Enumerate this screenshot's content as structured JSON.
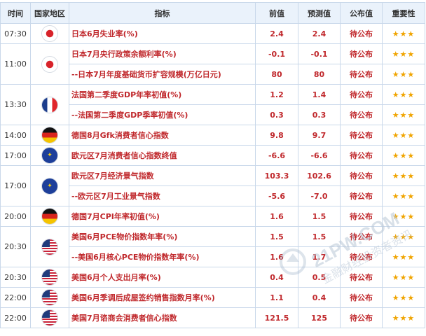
{
  "header": {
    "time": "时间",
    "country": "国家地区",
    "indicator": "指标",
    "previous": "前值",
    "forecast": "预测值",
    "published": "公布值",
    "importance": "重要性"
  },
  "rows": [
    {
      "time": "07:30",
      "flag": "jp",
      "flag_icon": "japan-flag-icon",
      "indicator": "日本6月失业率(%)",
      "previous": "2.4",
      "forecast": "2.4",
      "published": "待公布",
      "stars": "★★★"
    },
    {
      "time": "11:00",
      "flag": "jp",
      "flag_icon": "japan-flag-icon",
      "indicator": "日本7月央行政策余额利率(%)",
      "previous": "-0.1",
      "forecast": "-0.1",
      "published": "待公布",
      "stars": "★★★"
    },
    {
      "time": "",
      "flag": "",
      "flag_icon": "",
      "indicator": "--日本7月年度基础货币扩容规模(万亿日元)",
      "previous": "80",
      "forecast": "80",
      "published": "待公布",
      "stars": "★★★"
    },
    {
      "time": "13:30",
      "flag": "fr",
      "flag_icon": "france-flag-icon",
      "indicator": "法国第二季度GDP年率初值(%)",
      "previous": "1.2",
      "forecast": "1.4",
      "published": "待公布",
      "stars": "★★★"
    },
    {
      "time": "",
      "flag": "",
      "flag_icon": "",
      "indicator": "--法国第二季度GDP季率初值(%)",
      "previous": "0.3",
      "forecast": "0.3",
      "published": "待公布",
      "stars": "★★★"
    },
    {
      "time": "14:00",
      "flag": "de",
      "flag_icon": "germany-flag-icon",
      "indicator": "德国8月Gfk消费者信心指数",
      "previous": "9.8",
      "forecast": "9.7",
      "published": "待公布",
      "stars": "★★★"
    },
    {
      "time": "17:00",
      "flag": "eu",
      "flag_icon": "eu-flag-icon",
      "indicator": "欧元区7月消费者信心指数终值",
      "previous": "-6.6",
      "forecast": "-6.6",
      "published": "待公布",
      "stars": "★★★"
    },
    {
      "time": "17:00",
      "flag": "eu",
      "flag_icon": "eu-flag-icon",
      "indicator": "欧元区7月经济景气指数",
      "previous": "103.3",
      "forecast": "102.6",
      "published": "待公布",
      "stars": "★★★"
    },
    {
      "time": "",
      "flag": "",
      "flag_icon": "",
      "indicator": "--欧元区7月工业景气指数",
      "previous": "-5.6",
      "forecast": "-7.0",
      "published": "待公布",
      "stars": "★★★"
    },
    {
      "time": "20:00",
      "flag": "de",
      "flag_icon": "germany-flag-icon",
      "indicator": "德国7月CPI年率初值(%)",
      "previous": "1.6",
      "forecast": "1.5",
      "published": "待公布",
      "stars": "★★★"
    },
    {
      "time": "20:30",
      "flag": "us",
      "flag_icon": "usa-flag-icon",
      "indicator": "美国6月PCE物价指数年率(%)",
      "previous": "1.5",
      "forecast": "1.5",
      "published": "待公布",
      "stars": "★★★"
    },
    {
      "time": "",
      "flag": "",
      "flag_icon": "",
      "indicator": "--美国6月核心PCE物价指数年率(%)",
      "previous": "1.6",
      "forecast": "1.7",
      "published": "待公布",
      "stars": "★★★"
    },
    {
      "time": "20:30",
      "flag": "us",
      "flag_icon": "usa-flag-icon",
      "indicator": "美国6月个人支出月率(%)",
      "previous": "0.4",
      "forecast": "0.5",
      "published": "待公布",
      "stars": "★★★"
    },
    {
      "time": "22:00",
      "flag": "us",
      "flag_icon": "usa-flag-icon",
      "indicator": "美国6月季调后成屋签约销售指数月率(%)",
      "previous": "1.1",
      "forecast": "0.4",
      "published": "待公布",
      "stars": "★★★"
    },
    {
      "time": "22:00",
      "flag": "us",
      "flag_icon": "usa-flag-icon",
      "indicator": "美国7月谘商会消费者信心指数",
      "previous": "121.5",
      "forecast": "125",
      "published": "待公布",
      "stars": "★★★"
    }
  ],
  "watermark": {
    "line1": "21PW.COM",
    "line2": "金融财经投资者资讯",
    "logo_icon": "watermark-logo-icon"
  },
  "colors": {
    "accent_red": "#c0282c",
    "header_bg": "#eaf2fb",
    "border": "#c9d8ea",
    "star": "#f0a400"
  }
}
